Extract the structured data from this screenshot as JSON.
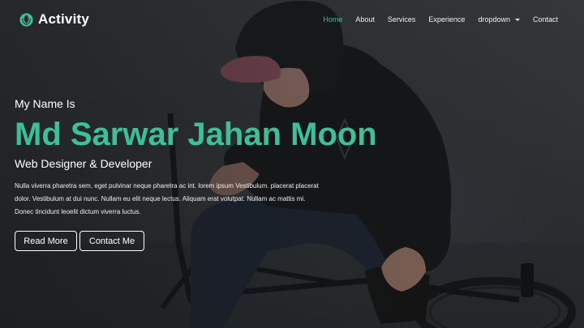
{
  "brand": {
    "name": "Activity",
    "icon": "rebel-logo-icon",
    "accent_color": "#3fbf96"
  },
  "nav": {
    "items": [
      {
        "label": "Home",
        "active": true
      },
      {
        "label": "About",
        "active": false
      },
      {
        "label": "Services",
        "active": false
      },
      {
        "label": "Experience",
        "active": false
      },
      {
        "label": "dropdown",
        "active": false,
        "has_caret": true
      },
      {
        "label": "Contact",
        "active": false
      }
    ]
  },
  "hero": {
    "intro": "My Name Is",
    "name": "Md Sarwar Jahan Moon",
    "role": "Web Designer & Developer",
    "description": [
      "Nulla viverra pharetra sem, eget pulvinar neque pharetra ac int. lorem ipsum Vestibulum. placerat placerat",
      "dolor. Vestibulum at dui nunc. Nullam eu elit neque lectus. Aliquam erat volutpat. Nullam ac mattis mi.",
      "Donec tincidunt leoelit dictum viverra luctus."
    ],
    "buttons": {
      "primary": "Read More",
      "secondary": "Contact Me"
    },
    "name_color": "#3fbf96"
  }
}
